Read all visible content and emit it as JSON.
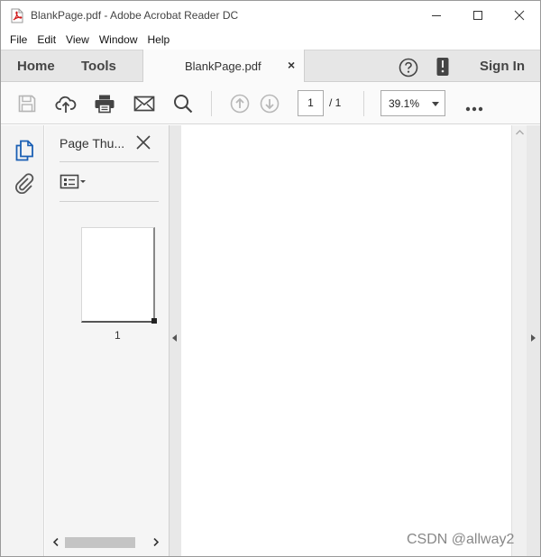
{
  "window": {
    "title": "BlankPage.pdf - Adobe Acrobat Reader DC",
    "app_icon": "pdf-file-icon",
    "controls": [
      "minimize-icon",
      "maximize-icon",
      "close-icon"
    ]
  },
  "menu": {
    "items": [
      {
        "label": "File"
      },
      {
        "label": "Edit"
      },
      {
        "label": "View"
      },
      {
        "label": "Window"
      },
      {
        "label": "Help"
      }
    ]
  },
  "tabs": {
    "home": "Home",
    "tools": "Tools",
    "document": "BlankPage.pdf",
    "document_close": "×",
    "sign_in": "Sign In",
    "help_icon": "help-circle-icon",
    "mobile_icon": "mobile-device-icon"
  },
  "toolbar": {
    "icons": [
      "save-icon",
      "cloud-upload-icon",
      "print-icon",
      "email-icon",
      "search-icon",
      "previous-page-icon",
      "next-page-icon",
      "more-options-icon"
    ],
    "current_page": "1",
    "page_total": "/  1",
    "zoom": "39.1%"
  },
  "sidebar": {
    "icons": [
      "page-thumbnails-icon",
      "attachments-icon"
    ],
    "active_color": "#1a5fb4"
  },
  "thumbnails_panel": {
    "title": "Page Thu...",
    "options_icon": "thumbnail-options-icon",
    "pages": [
      {
        "label": "1"
      }
    ]
  },
  "watermark": "CSDN @allway2",
  "colors": {
    "tab_bar": "#e6e6e6",
    "toolbar": "#fafafa",
    "panel": "#f5f5f5",
    "document": "#ffffff"
  }
}
